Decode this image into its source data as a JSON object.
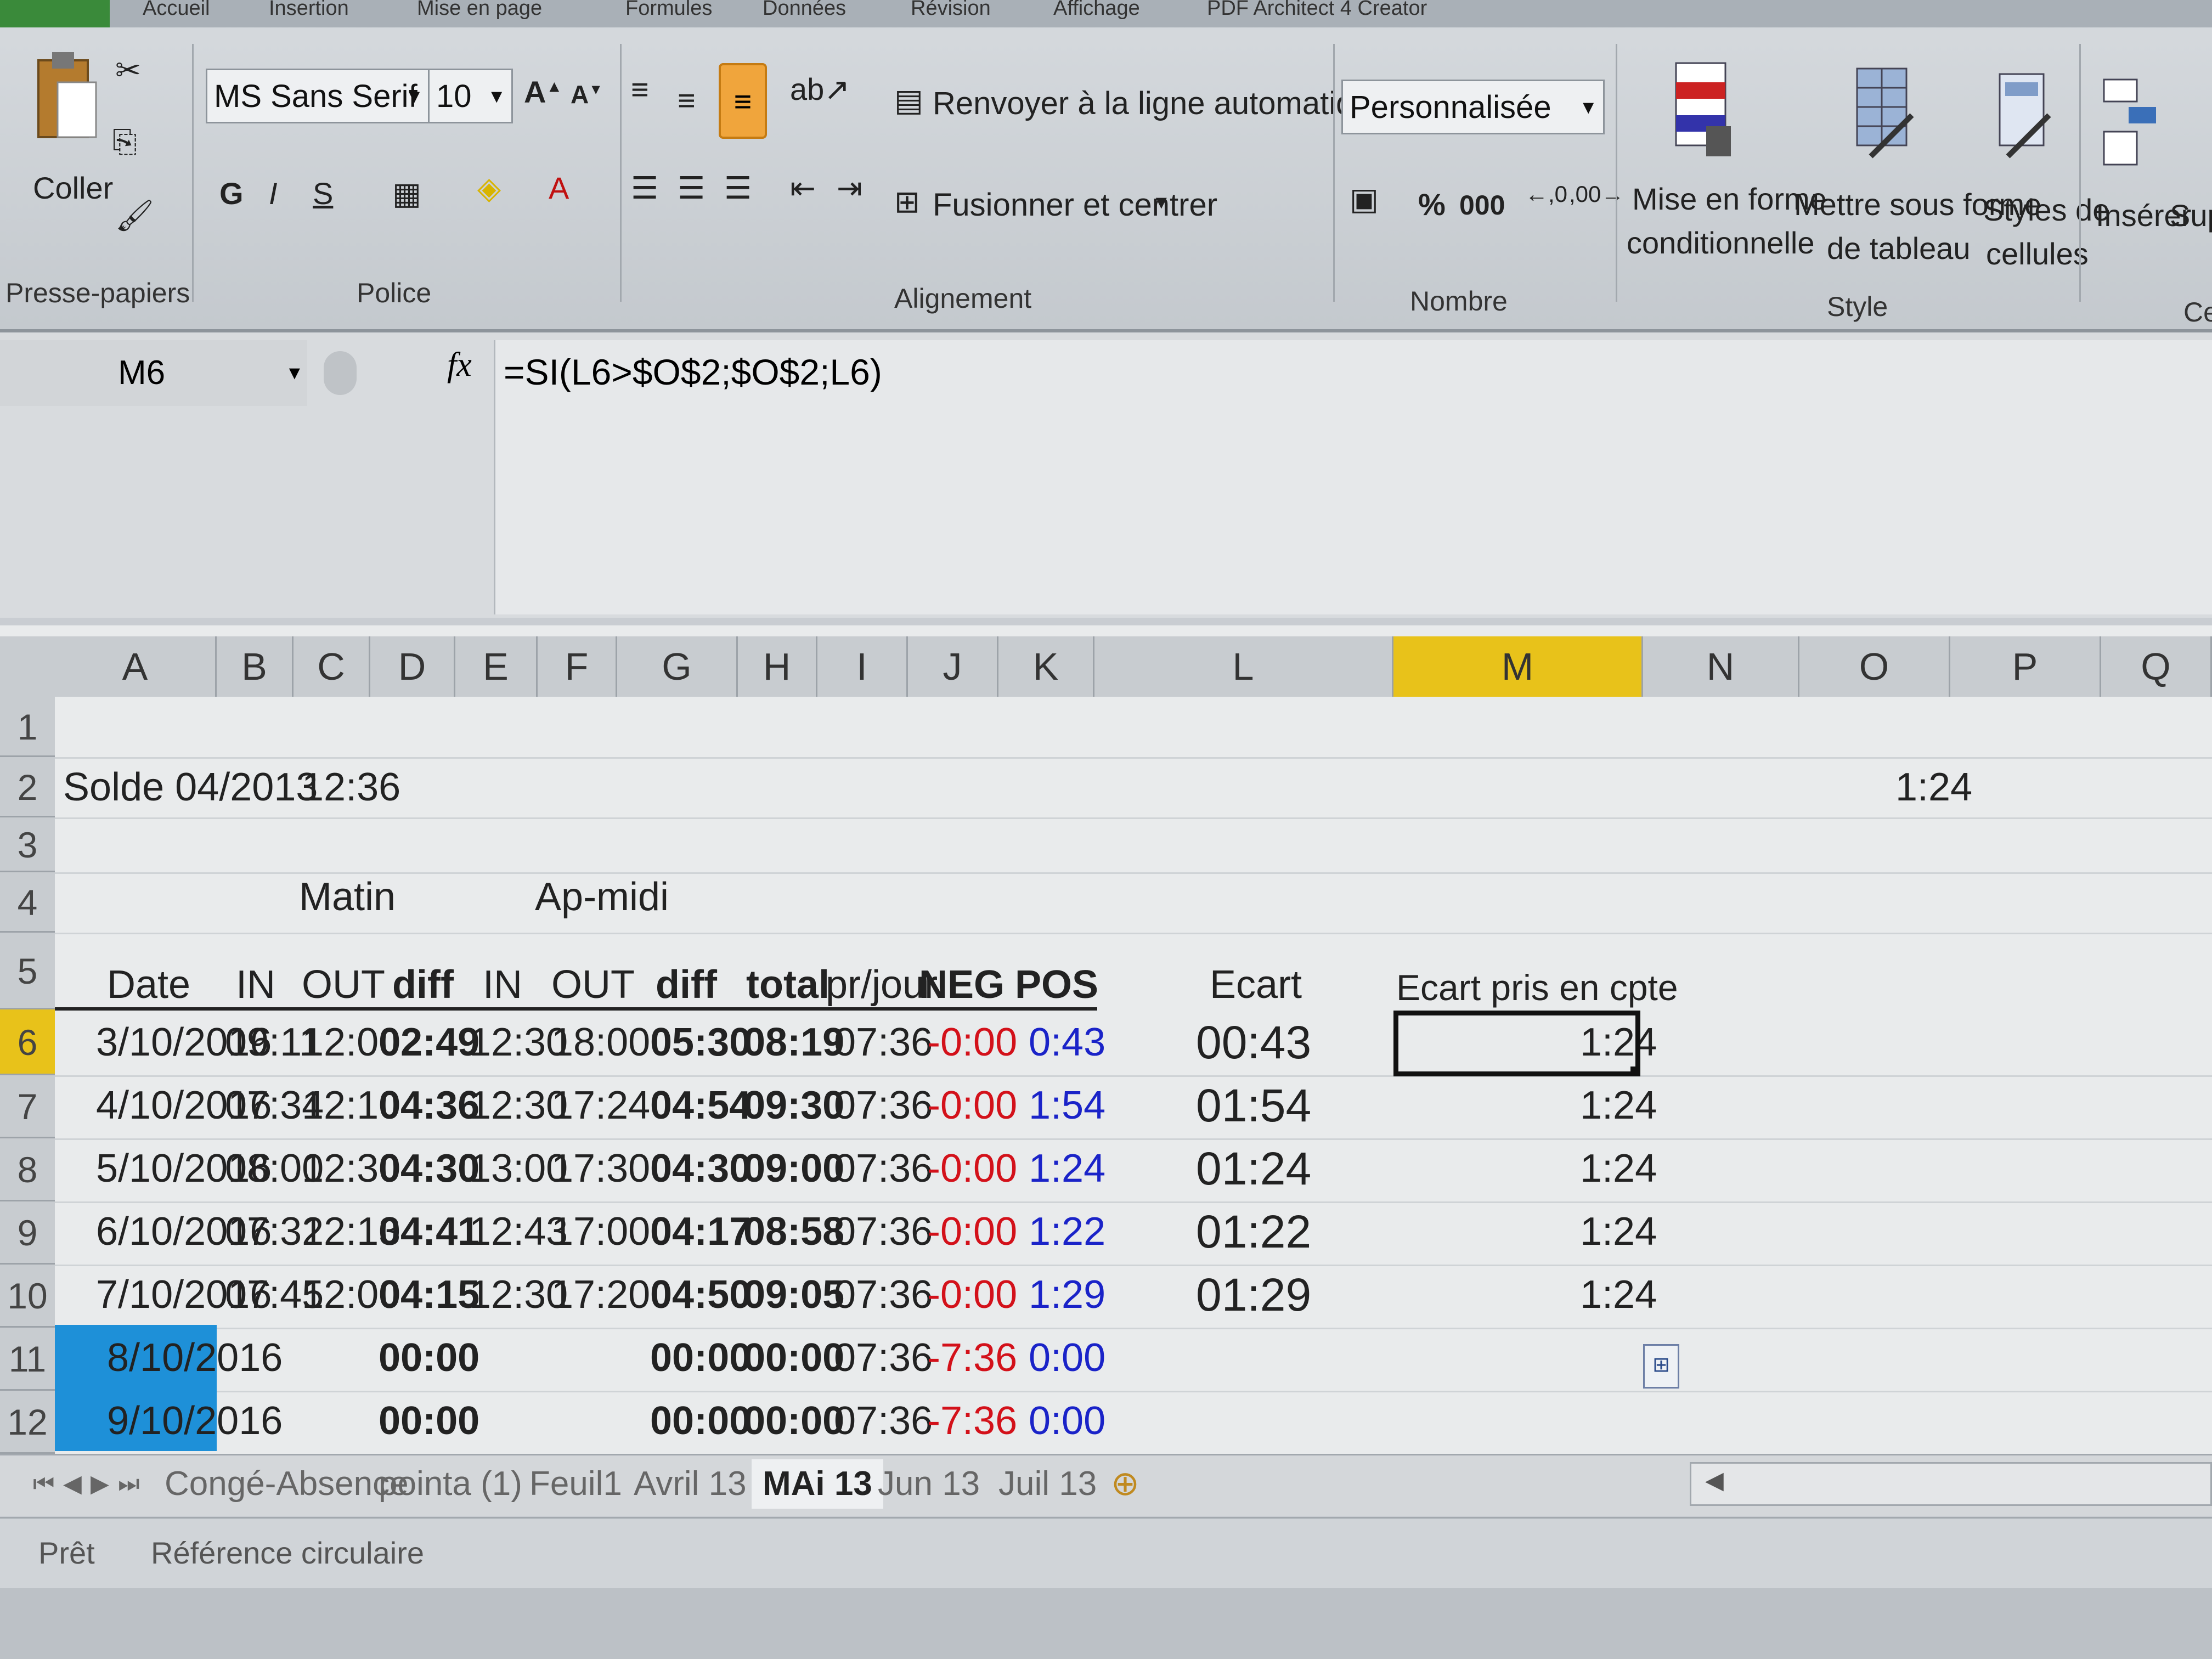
{
  "ribbon": {
    "tabs": [
      "Accueil",
      "Insertion",
      "Mise en page",
      "Formules",
      "Données",
      "Révision",
      "Affichage",
      "PDF Architect 4 Creator"
    ],
    "clipboard": {
      "paste_label": "Coller",
      "group_label": "Presse-papiers"
    },
    "font": {
      "name": "MS Sans Serif",
      "size": "10",
      "bold": "G",
      "italic": "I",
      "underline": "S",
      "group_label": "Police"
    },
    "alignment": {
      "wrap_label": "Renvoyer à la ligne automatiquement",
      "merge_label": "Fusionner et centrer",
      "group_label": "Alignement"
    },
    "number": {
      "format": "Personnalisée",
      "percent": "%",
      "thousands": "000",
      "group_label": "Nombre"
    },
    "styles": {
      "cond_format_l1": "Mise en forme",
      "cond_format_l2": "conditionnelle",
      "table_l1": "Mettre sous forme",
      "table_l2": "de tableau",
      "cell_styles_l1": "Styles de",
      "cell_styles_l2": "cellules",
      "group_label": "Style"
    },
    "cells": {
      "insert_label": "Insérer",
      "delete_label": "Sup",
      "group_label": "Ce"
    }
  },
  "formula_bar": {
    "name_box": "M6",
    "fx": "fx",
    "formula": "=SI(L6>$O$2;$O$2;L6)"
  },
  "columns": [
    "A",
    "B",
    "C",
    "D",
    "E",
    "F",
    "G",
    "H",
    "I",
    "J",
    "K",
    "L",
    "M",
    "N",
    "O",
    "P",
    "Q"
  ],
  "rows": [
    "1",
    "2",
    "3",
    "4",
    "5",
    "6",
    "7",
    "8",
    "9",
    "10",
    "11",
    "12"
  ],
  "selected_cell": {
    "column": "M",
    "row": "6"
  },
  "sheet": {
    "A2": "Solde 04/2013",
    "C2": "12:36",
    "O2": "1:24",
    "C4": "Matin",
    "F4": "Ap-midi",
    "headers": {
      "A": "Date",
      "B": "IN",
      "C": "OUT",
      "D": "diff",
      "E": "IN",
      "F": "OUT",
      "G": "diff",
      "H": "total",
      "I": "pr/jour",
      "J": "NEG",
      "K": "POS",
      "L": "Ecart",
      "M": "Ecart pris en cpte"
    },
    "data_rows": [
      {
        "A": "3/10/2016",
        "B": "09:11",
        "C": "12:00",
        "D": "02:49",
        "E": "12:30",
        "F": "18:00",
        "G": "05:30",
        "H": "08:19",
        "I": "07:36",
        "J": "-0:00",
        "K": "0:43",
        "L": "00:43",
        "M": "1:24"
      },
      {
        "A": "4/10/2016",
        "B": "07:34",
        "C": "12:10",
        "D": "04:36",
        "E": "12:30",
        "F": "17:24",
        "G": "04:54",
        "H": "09:30",
        "I": "07:36",
        "J": "-0:00",
        "K": "1:54",
        "L": "01:54",
        "M": "1:24"
      },
      {
        "A": "5/10/2016",
        "B": "08:00",
        "C": "12:30",
        "D": "04:30",
        "E": "13:00",
        "F": "17:30",
        "G": "04:30",
        "H": "09:00",
        "I": "07:36",
        "J": "-0:00",
        "K": "1:24",
        "L": "01:24",
        "M": "1:24"
      },
      {
        "A": "6/10/2016",
        "B": "07:32",
        "C": "12:13",
        "D": "04:41",
        "E": "12:43",
        "F": "17:00",
        "G": "04:17",
        "H": "08:58",
        "I": "07:36",
        "J": "-0:00",
        "K": "1:22",
        "L": "01:22",
        "M": "1:24"
      },
      {
        "A": "7/10/2016",
        "B": "07:45",
        "C": "12:00",
        "D": "04:15",
        "E": "12:30",
        "F": "17:20",
        "G": "04:50",
        "H": "09:05",
        "I": "07:36",
        "J": "-0:00",
        "K": "1:29",
        "L": "01:29",
        "M": "1:24"
      },
      {
        "A": "8/10/2016",
        "B": "",
        "C": "",
        "D": "00:00",
        "E": "",
        "F": "",
        "G": "00:00",
        "H": "00:00",
        "I": "07:36",
        "J": "-7:36",
        "K": "0:00",
        "L": "",
        "M": ""
      },
      {
        "A": "9/10/2016",
        "B": "",
        "C": "",
        "D": "00:00",
        "E": "",
        "F": "",
        "G": "00:00",
        "H": "00:00",
        "I": "07:36",
        "J": "-7:36",
        "K": "0:00",
        "L": "",
        "M": ""
      }
    ]
  },
  "sheet_tabs": [
    "Congé-Absence",
    "pointa (1)",
    "Feuil1",
    "Avril 13",
    "MAi 13",
    "Jun 13",
    "Juil 13"
  ],
  "active_sheet": "MAi 13",
  "status": {
    "ready": "Prêt",
    "circular": "Référence circulaire"
  },
  "colors": {
    "highlight_date": "#1e90d8",
    "selected_header": "#e8c21a",
    "neg": "#d3111a",
    "pos": "#1a23c8"
  }
}
